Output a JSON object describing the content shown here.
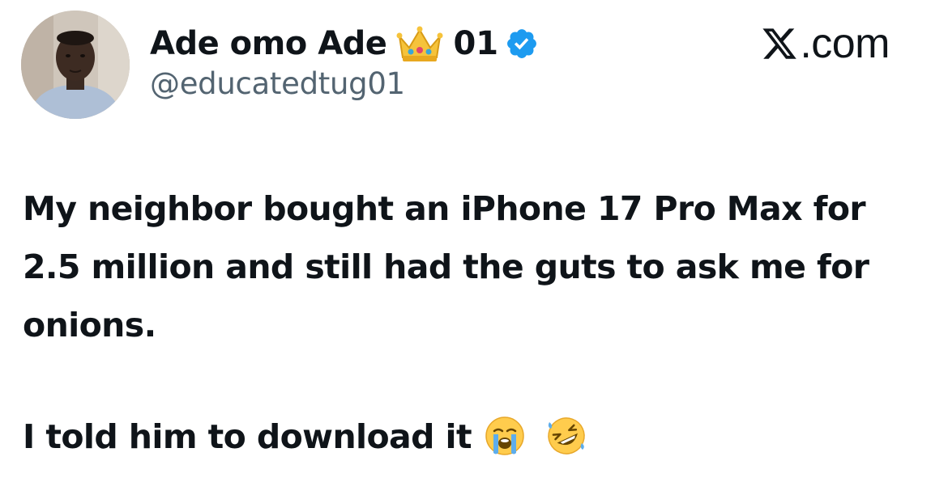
{
  "author": {
    "display_name": "Ade omo Ade",
    "name_emoji": "crown-icon",
    "name_suffix": "01",
    "verified_badge": "verified-icon",
    "handle": "@educatedtug01",
    "avatar": "avatar-photo"
  },
  "brand": {
    "logo": "x-logo-icon",
    "suffix": ".com"
  },
  "tweet": {
    "lines": [
      "My neighbor bought an iPhone 17 Pro Max for",
      "2.5 million and still had the guts to ask me for",
      "onions.",
      "I told him to download it"
    ],
    "emojis": [
      "loudly-crying-face-icon",
      "rolling-on-floor-laughing-icon"
    ]
  },
  "colors": {
    "text": "#0f1419",
    "secondary_text": "#536471",
    "verified_blue": "#1d9bf0",
    "background": "#ffffff"
  }
}
